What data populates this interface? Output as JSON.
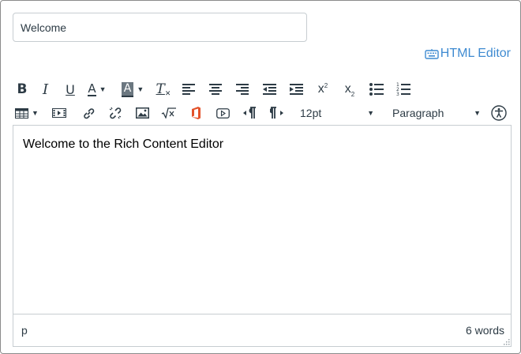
{
  "title_field": {
    "value": "Welcome"
  },
  "html_editor_link": {
    "label": "HTML Editor",
    "icon": "keyboard-icon"
  },
  "toolbar": {
    "bold": "B",
    "italic": "I",
    "underline": "U",
    "text_color": "A",
    "bg_color": "A",
    "clear_format": "T",
    "superscript": "x",
    "superscript_mark": "2",
    "subscript": "x",
    "subscript_mark": "2",
    "accent_color": "#2d3b45",
    "office_color": "#e3522a",
    "font_size": "12pt",
    "block_format": "Paragraph"
  },
  "editor": {
    "content": "Welcome to the Rich Content Editor"
  },
  "statusbar": {
    "path": "p",
    "word_count": "6 words"
  },
  "colors": {
    "link": "#3f8bd1",
    "border": "#c7cdd1",
    "text": "#2d3b45"
  }
}
